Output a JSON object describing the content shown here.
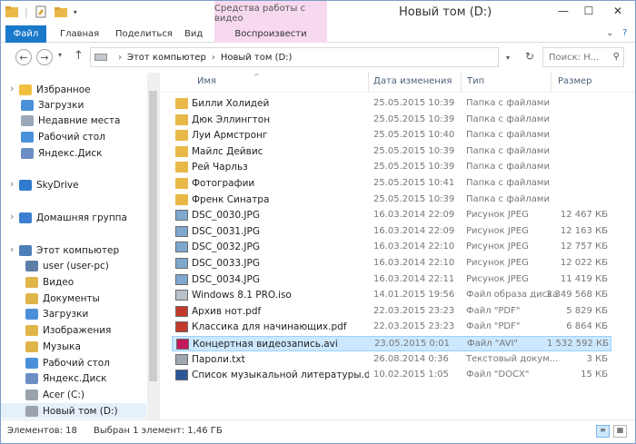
{
  "window": {
    "title": "Новый том (D:)",
    "context_tab_header": "Средства работы с видео"
  },
  "ribbon": {
    "tabs": [
      "Файл",
      "Главная",
      "Поделиться",
      "Вид",
      "Воспроизвести"
    ]
  },
  "address": {
    "crumbs": [
      "Этот компьютер",
      "Новый том (D:)"
    ],
    "search_placeholder": "Поиск: Н..."
  },
  "sidebar": {
    "items": [
      {
        "label": "Избранное",
        "icon": "star-icon",
        "color": "#f0c040"
      },
      {
        "label": "Загрузки",
        "icon": "downloads-icon",
        "color": "#4a90d9"
      },
      {
        "label": "Недавние места",
        "icon": "recent-places-icon",
        "color": "#9aa8b8"
      },
      {
        "label": "Рабочий стол",
        "icon": "desktop-icon",
        "color": "#4a90d9"
      },
      {
        "label": "Яндекс.Диск",
        "icon": "yandex-disk-icon",
        "color": "#6b8ec4"
      },
      {
        "label": "SkyDrive",
        "icon": "cloud-icon",
        "color": "#2e7bcf"
      },
      {
        "label": "Домашняя группа",
        "icon": "homegroup-icon",
        "color": "#3a7fd0"
      },
      {
        "label": "Этот компьютер",
        "icon": "computer-icon",
        "color": "#4f7fb8"
      },
      {
        "label": "user (user-pc)",
        "icon": "network-computer-icon",
        "color": "#5d7fa6"
      },
      {
        "label": "Видео",
        "icon": "videos-icon",
        "color": "#e0b64a"
      },
      {
        "label": "Документы",
        "icon": "documents-icon",
        "color": "#e0b64a"
      },
      {
        "label": "Загрузки",
        "icon": "downloads-icon",
        "color": "#4a90d9"
      },
      {
        "label": "Изображения",
        "icon": "pictures-icon",
        "color": "#e0b64a"
      },
      {
        "label": "Музыка",
        "icon": "music-icon",
        "color": "#e0b64a"
      },
      {
        "label": "Рабочий стол",
        "icon": "desktop-icon",
        "color": "#4a90d9"
      },
      {
        "label": "Яндекс.Диск",
        "icon": "yandex-disk-icon",
        "color": "#6b8ec4"
      },
      {
        "label": "Acer (C:)",
        "icon": "drive-icon",
        "color": "#9ba4ad"
      },
      {
        "label": "Новый том (D:)",
        "icon": "drive-icon",
        "color": "#9ba4ad"
      }
    ]
  },
  "columns": {
    "name": "Имя",
    "date": "Дата изменения",
    "type": "Тип",
    "size": "Размер"
  },
  "files": [
    {
      "name": "Билли Холидей",
      "date": "25.05.2015 10:39",
      "type": "Папка с файлами",
      "size": "",
      "icon": "folder-icon"
    },
    {
      "name": "Дюк Эллингтон",
      "date": "25.05.2015 10:39",
      "type": "Папка с файлами",
      "size": "",
      "icon": "folder-icon"
    },
    {
      "name": "Луи Армстронг",
      "date": "25.05.2015 10:40",
      "type": "Папка с файлами",
      "size": "",
      "icon": "folder-icon"
    },
    {
      "name": "Майлс Дейвис",
      "date": "25.05.2015 10:39",
      "type": "Папка с файлами",
      "size": "",
      "icon": "folder-icon"
    },
    {
      "name": "Рей Чарльз",
      "date": "25.05.2015 10:39",
      "type": "Папка с файлами",
      "size": "",
      "icon": "folder-icon"
    },
    {
      "name": "Фотографии",
      "date": "25.05.2015 10:41",
      "type": "Папка с файлами",
      "size": "",
      "icon": "folder-icon"
    },
    {
      "name": "Френк Синатра",
      "date": "25.05.2015 10:39",
      "type": "Папка с файлами",
      "size": "",
      "icon": "folder-icon"
    },
    {
      "name": "DSC_0030.JPG",
      "date": "16.03.2014 22:09",
      "type": "Рисунок JPEG",
      "size": "12 467 КБ",
      "icon": "image-icon"
    },
    {
      "name": "DSC_0031.JPG",
      "date": "16.03.2014 22:09",
      "type": "Рисунок JPEG",
      "size": "12 163 КБ",
      "icon": "image-icon"
    },
    {
      "name": "DSC_0032.JPG",
      "date": "16.03.2014 22:10",
      "type": "Рисунок JPEG",
      "size": "12 757 КБ",
      "icon": "image-icon"
    },
    {
      "name": "DSC_0033.JPG",
      "date": "16.03.2014 22:10",
      "type": "Рисунок JPEG",
      "size": "12 022 КБ",
      "icon": "image-icon"
    },
    {
      "name": "DSC_0034.JPG",
      "date": "16.03.2014 22:11",
      "type": "Рисунок JPEG",
      "size": "11 419 КБ",
      "icon": "image-icon"
    },
    {
      "name": "Windows 8.1 PRO.iso",
      "date": "14.01.2015 19:56",
      "type": "Файл образа диска",
      "size": "3 349 568 КБ",
      "icon": "disc-image-icon"
    },
    {
      "name": "Архив нот.pdf",
      "date": "22.03.2015 23:23",
      "type": "Файл \"PDF\"",
      "size": "5 829 КБ",
      "icon": "pdf-icon"
    },
    {
      "name": "Классика для начинающих.pdf",
      "date": "22.03.2015 23:23",
      "type": "Файл \"PDF\"",
      "size": "6 864 КБ",
      "icon": "pdf-icon"
    },
    {
      "name": "Концертная видеозапись.avi",
      "date": "23.05.2015 0:01",
      "type": "Файл \"AVI\"",
      "size": "1 532 592 КБ",
      "icon": "video-file-icon",
      "selected": true
    },
    {
      "name": "Пароли.txt",
      "date": "26.08.2014 0:36",
      "type": "Текстовый докум...",
      "size": "3 КБ",
      "icon": "text-file-icon"
    },
    {
      "name": "Список музыкальной литературы.docx",
      "date": "10.02.2015 1:05",
      "type": "Файл \"DOCX\"",
      "size": "15 КБ",
      "icon": "word-doc-icon"
    }
  ],
  "status": {
    "count": "Элементов: 18",
    "selection": "Выбран 1 элемент: 1,46 ГБ"
  },
  "colors": {
    "accent": "#1979ca",
    "selection": "#cce8ff",
    "context_tab": "#f7d9ef",
    "folder": "#e8b948"
  }
}
